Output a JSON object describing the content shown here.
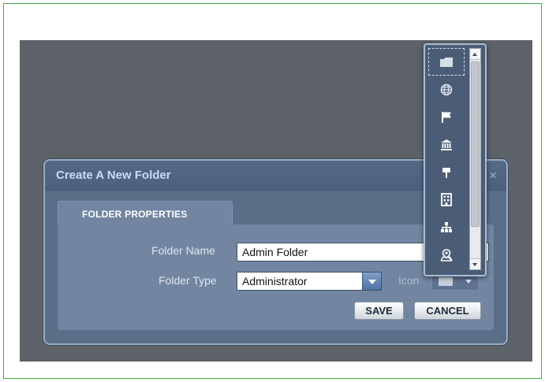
{
  "dialog": {
    "title": "Create A New Folder",
    "close_glyph": "×",
    "tab_label": "FOLDER PROPERTIES",
    "fields": {
      "folder_name_label": "Folder Name",
      "folder_name_value": "Admin Folder",
      "folder_type_label": "Folder Type",
      "folder_type_value": "Administrator",
      "icon_label": "Icon"
    },
    "buttons": {
      "save": "SAVE",
      "cancel": "CANCEL"
    }
  },
  "icon_picker": {
    "icons": [
      "folder-icon",
      "globe-icon",
      "flag-icon",
      "bank-icon",
      "signpost-icon",
      "building-icon",
      "org-chart-icon",
      "map-marker-icon"
    ],
    "selected_index": 0
  },
  "colors": {
    "title_text": "#c9dcf2",
    "dialog_bg": "#5b6e88",
    "panel_bg": "#7286a2",
    "frame_border": "#3fae3f"
  }
}
